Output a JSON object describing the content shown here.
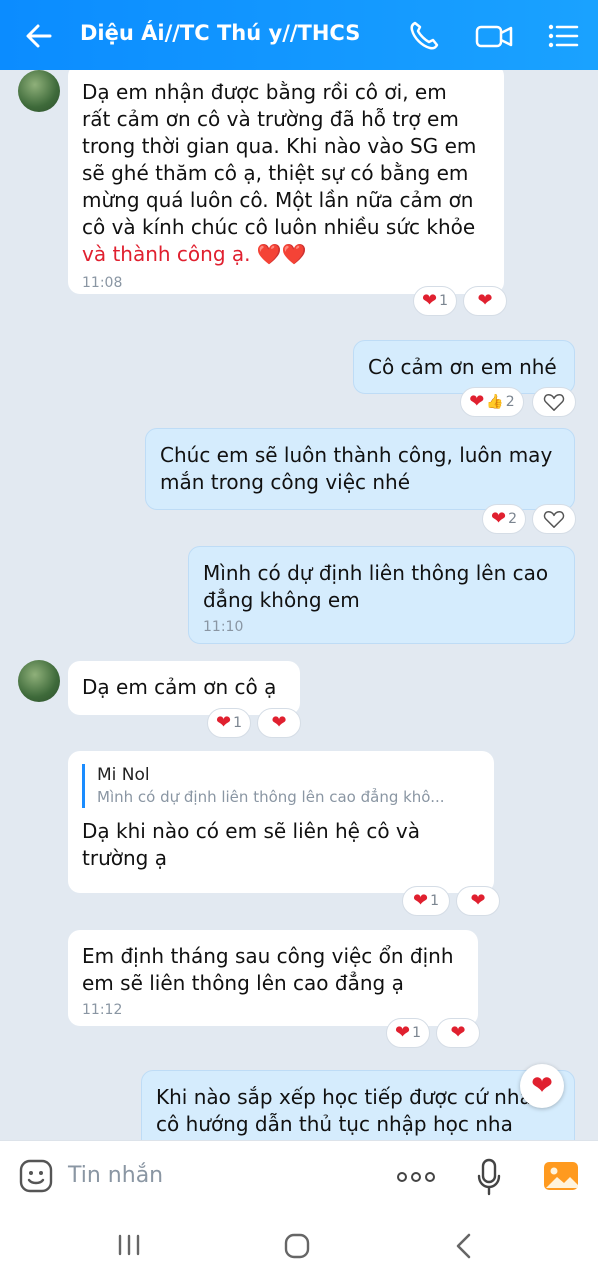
{
  "header": {
    "title": "Diệu Ái//TC Thú y//THCS",
    "icons": [
      "back-arrow-icon",
      "phone-icon",
      "video-call-icon",
      "menu-list-icon"
    ]
  },
  "messages": [
    {
      "text_lines": [
        "Dạ em nhận được bằng rồi cô ơi, em",
        "rất cảm ơn cô và trường đã hỗ trợ em",
        "trong thời gian qua. Khi nào vào SG em",
        "sẽ ghé thăm cô ạ, thiệt sự có bằng em",
        "mừng quá luôn cô. Một lần nữa cảm ơn",
        "cô và kính chúc cô luôn nhiều sức khỏe",
        "và thành công ạ. ❤️❤️"
      ],
      "time": "11:08",
      "reaction_count": "1"
    },
    {
      "text": "Cô cảm ơn em nhé",
      "reaction_count": "2"
    },
    {
      "text_lines": [
        "Chúc em sẽ luôn thành công, luôn may",
        "mắn trong công việc nhé"
      ],
      "reaction_count": "2"
    },
    {
      "text_lines": [
        "Mình có dự định liên thông lên cao",
        "đẳng không em"
      ],
      "time": "11:10"
    },
    {
      "text": "Dạ em cảm ơn cô ạ",
      "reaction_count": "1"
    },
    {
      "quote_name": "Mi Nol",
      "quote_text": "Mình có dự định liên thông lên cao đẳng khô...",
      "text_lines": [
        "Dạ khi nào có em sẽ liên hệ cô và",
        "trường ạ"
      ],
      "reaction_count": "1"
    },
    {
      "text_lines": [
        "Em định tháng sau công việc ổn định",
        "em sẽ liên thông lên cao đẳng ạ"
      ],
      "time": "11:12",
      "reaction_count": "1"
    },
    {
      "text_lines": [
        "Khi nào sắp xếp học tiếp được cứ nhắn",
        "cô hướng dẫn thủ tục nhập học nha"
      ]
    }
  ],
  "input": {
    "placeholder": "Tin nhắn"
  },
  "colors": {
    "header": "#0b8cff",
    "outgoing_bubble": "#d5ecfd",
    "incoming_bubble": "#ffffff",
    "heart": "#e0202f"
  }
}
